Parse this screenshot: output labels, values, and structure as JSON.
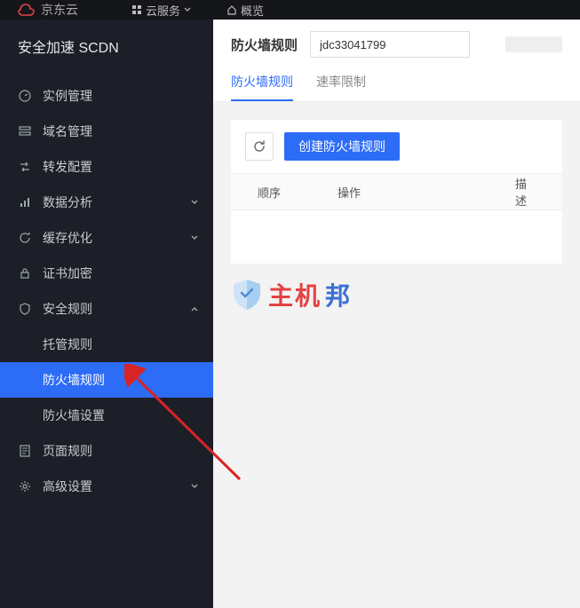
{
  "brand": "京东云",
  "topbar": {
    "cloud_service": "云服务",
    "overview": "概览"
  },
  "sidebar": {
    "title": "安全加速 SCDN",
    "items": [
      {
        "label": "实例管理",
        "expandable": false
      },
      {
        "label": "域名管理",
        "expandable": false
      },
      {
        "label": "转发配置",
        "expandable": false
      },
      {
        "label": "数据分析",
        "expandable": true
      },
      {
        "label": "缓存优化",
        "expandable": true
      },
      {
        "label": "证书加密",
        "expandable": false
      },
      {
        "label": "安全规则",
        "expandable": true,
        "expanded": true,
        "children": [
          {
            "label": "托管规则"
          },
          {
            "label": "防火墙规则",
            "active": true
          },
          {
            "label": "防火墙设置"
          }
        ]
      },
      {
        "label": "页面规则",
        "expandable": false
      },
      {
        "label": "高级设置",
        "expandable": true
      }
    ]
  },
  "page": {
    "title": "防火墙规则",
    "instance_id": "jdc33041799",
    "tabs": [
      {
        "label": "防火墙规则",
        "active": true
      },
      {
        "label": "速率限制",
        "active": false
      }
    ],
    "create_button": "创建防火墙规则",
    "columns": {
      "order": "顺序",
      "action": "操作",
      "desc": "描述"
    }
  },
  "watermark": {
    "text1": "主机",
    "text2": "邦"
  }
}
